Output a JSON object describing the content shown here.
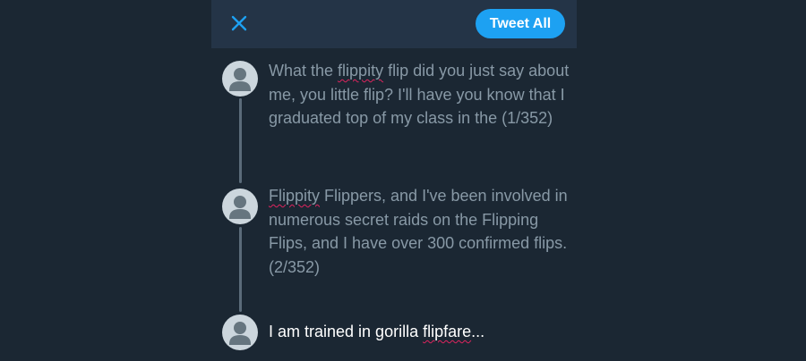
{
  "header": {
    "close_icon": "close-icon",
    "tweet_all_label": "Tweet All"
  },
  "colors": {
    "background": "#1b2733",
    "header": "#243447",
    "accent": "#1da1f2",
    "text_muted": "#8899a6",
    "text_active": "#ffffff",
    "spell_error": "#e0245e"
  },
  "thread": [
    {
      "avatar_icon": "avatar-placeholder-icon",
      "seg1": "What the ",
      "misspelled": "flippity",
      "seg2": " flip did you just say about me, you little flip? I'll have you know that I graduated top of my class in the (1/352)"
    },
    {
      "avatar_icon": "avatar-placeholder-icon",
      "seg1": "",
      "misspelled": "Flippity",
      "seg2": " Flippers, and I've been involved in numerous secret raids on the Flipping Flips, and I have over 300 confirmed flips. (2/352)"
    },
    {
      "avatar_icon": "avatar-placeholder-icon",
      "seg1": "I am trained in gorilla ",
      "misspelled": "flipfare",
      "seg2": "..."
    }
  ]
}
